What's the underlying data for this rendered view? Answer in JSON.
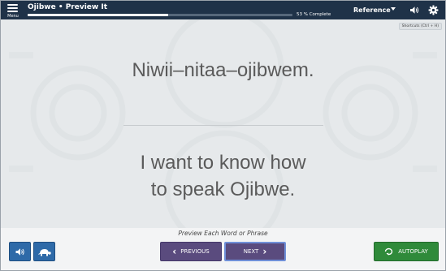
{
  "header": {
    "menu_label": "Menu",
    "menu_icon": "hamburger-icon",
    "course_title": "Ojibwe • Preview It",
    "progress_percent": 53,
    "progress_text": "53 % Complete",
    "reference_label": "Reference",
    "audio_icon": "speaker-icon",
    "settings_icon": "gear-icon"
  },
  "shortcuts_hint": "Shortcuts (Ctrl + H)",
  "card": {
    "ojibwe_phrase": "Niwii–nitaa–ojibwem.",
    "english_line_1": "I want to know how",
    "english_line_2": "to speak Ojibwe."
  },
  "footer": {
    "instruction": "Preview Each Word or Phrase",
    "audio_icon": "speaker-icon",
    "slow_icon": "turtle-icon",
    "previous_label": "PREVIOUS",
    "next_label": "NEXT",
    "autoplay_label": "AUTOPLAY",
    "autoplay_icon": "autoplay-icon"
  },
  "colors": {
    "header_bg": "#1f3248",
    "nav_button": "#5a4b7e",
    "audio_button": "#2e6aa8",
    "autoplay_button": "#2f8a3a",
    "next_focus_ring": "#6f8fd8"
  }
}
